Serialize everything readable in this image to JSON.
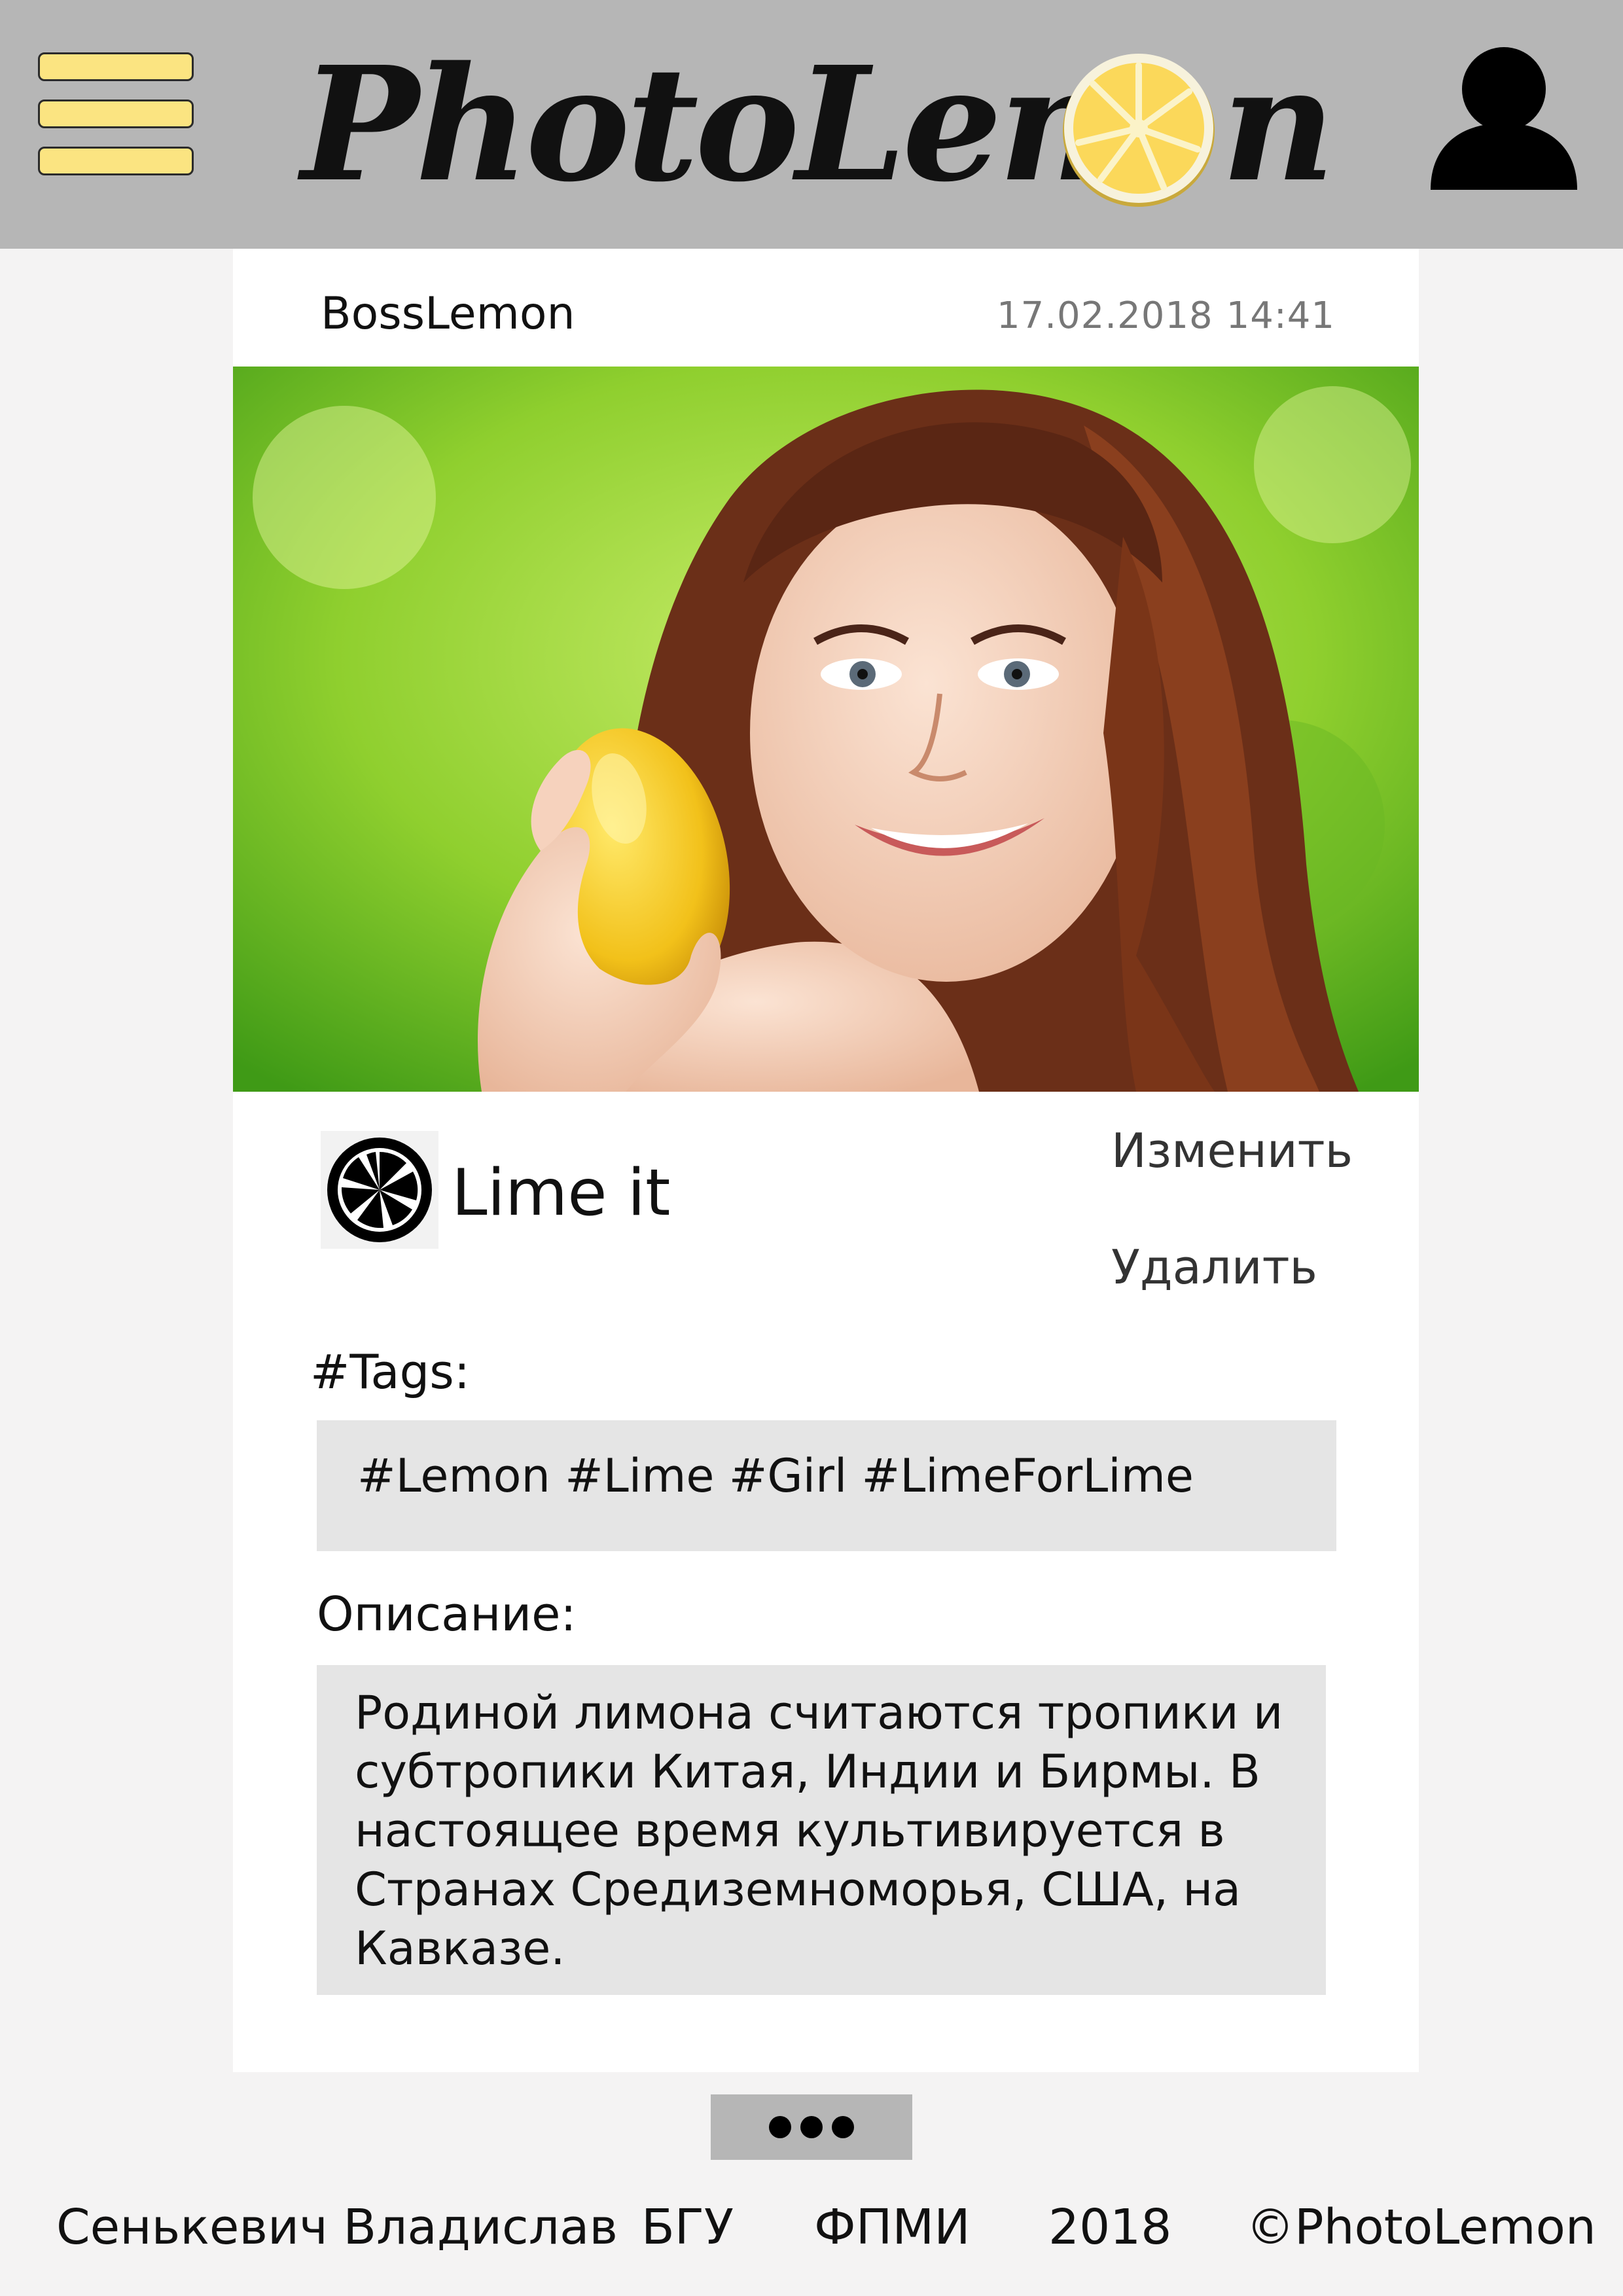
{
  "header": {
    "logo_text": "PhotoLem",
    "logo_tail": "n",
    "brand_yellow": "#fbe481",
    "icons": [
      "hamburger-menu-icon",
      "lemon-slice-icon",
      "user-profile-icon"
    ]
  },
  "post": {
    "username": "BossLemon",
    "date": "17.02.2018",
    "time": "14:41",
    "lime_label": "Lime it",
    "edit_label": "Изменить",
    "delete_label": "Удалить",
    "tags_heading": "#Tags:",
    "tags": "#Lemon #Lime #Girl #LimeForLime",
    "description_heading": "Описание:",
    "description_lines": [
      "Родиной лимона считаются тропики и",
      "субтропики Китая, Индии и Бирмы. В",
      "настоящее время культивируется в",
      "Странах Средиземноморья, США, на",
      "Кавказе."
    ]
  },
  "footer": {
    "author": "Сенькевич Владислав",
    "university": "БГУ",
    "faculty": "ФПМИ",
    "year": "2018",
    "copyright": "©PhotoLemon"
  }
}
